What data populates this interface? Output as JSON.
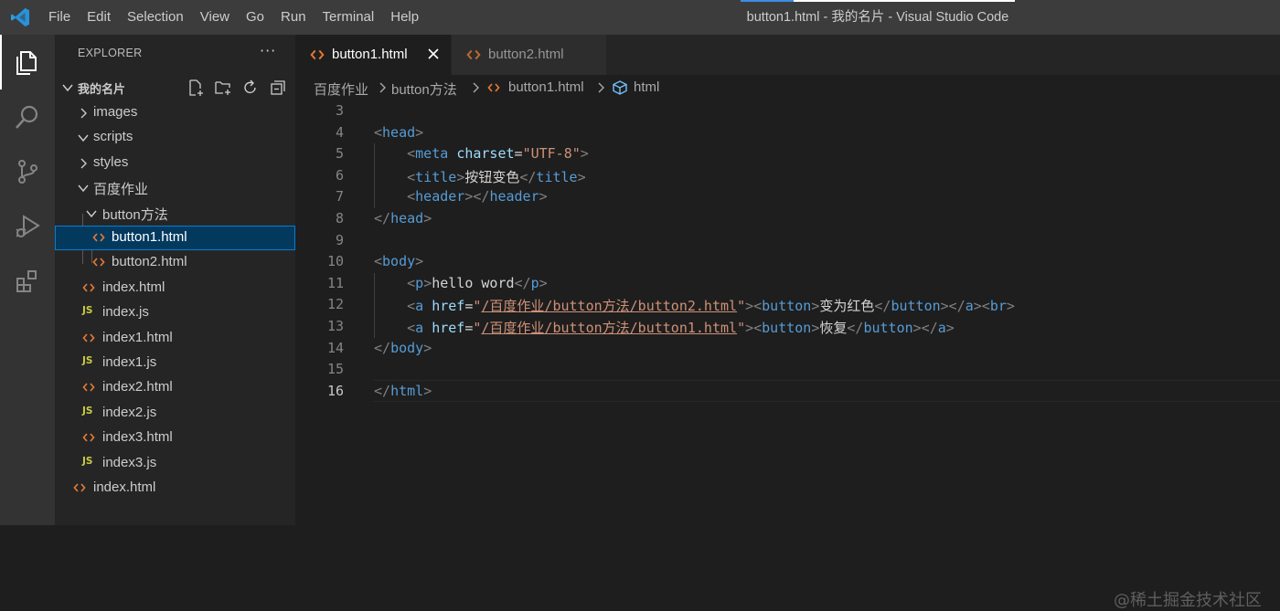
{
  "titlebar": {
    "logo_icon": "vscode-icon",
    "menu": [
      "File",
      "Edit",
      "Selection",
      "View",
      "Go",
      "Run",
      "Terminal",
      "Help"
    ],
    "window_title": "button1.html - 我的名片 - Visual Studio Code"
  },
  "activitybar": {
    "items": [
      "explorer-icon",
      "search-icon",
      "source-control-icon",
      "run-debug-icon",
      "extensions-icon"
    ]
  },
  "sidebar": {
    "title": "EXPLORER",
    "more_label": "···",
    "folder_name": "我的名片",
    "tree": [
      {
        "label": "images",
        "type": "folder",
        "expanded": false
      },
      {
        "label": "scripts",
        "type": "folder",
        "expanded": true
      },
      {
        "label": "styles",
        "type": "folder",
        "expanded": false
      },
      {
        "label": "百度作业",
        "type": "folder",
        "expanded": true
      },
      {
        "label": "button方法",
        "type": "folder",
        "expanded": true
      },
      {
        "label": "button1.html",
        "type": "html",
        "selected": true
      },
      {
        "label": "button2.html",
        "type": "html"
      },
      {
        "label": "index.html",
        "type": "html"
      },
      {
        "label": "index.js",
        "type": "js"
      },
      {
        "label": "index1.html",
        "type": "html"
      },
      {
        "label": "index1.js",
        "type": "js"
      },
      {
        "label": "index2.html",
        "type": "html"
      },
      {
        "label": "index2.js",
        "type": "js"
      },
      {
        "label": "index3.html",
        "type": "html"
      },
      {
        "label": "index3.js",
        "type": "js"
      },
      {
        "label": "index.html",
        "type": "html"
      }
    ],
    "js_badge": "JS"
  },
  "tabs": [
    {
      "label": "button1.html",
      "active": true
    },
    {
      "label": "button2.html",
      "active": false
    }
  ],
  "breadcrumbs": [
    "百度作业",
    "button方法",
    "button1.html",
    "html"
  ],
  "editor": {
    "active_line": "16",
    "lines": [
      {
        "n": "3",
        "text": ""
      },
      {
        "n": "4",
        "text": "<head>"
      },
      {
        "n": "5",
        "text": "    <meta charset=\"UTF-8\">"
      },
      {
        "n": "6",
        "text": "    <title>按钮变色</title>"
      },
      {
        "n": "7",
        "text": "    <header></header>"
      },
      {
        "n": "8",
        "text": "</head>"
      },
      {
        "n": "9",
        "text": ""
      },
      {
        "n": "10",
        "text": "<body>"
      },
      {
        "n": "11",
        "text": "    <p>hello word</p>"
      },
      {
        "n": "12",
        "text": "    <a href=\"/百度作业/button方法/button2.html\"><button>变为红色</button></a><br>"
      },
      {
        "n": "13",
        "text": "    <a href=\"/百度作业/button方法/button1.html\"><button>恢复</button></a>"
      },
      {
        "n": "14",
        "text": "</body>"
      },
      {
        "n": "15",
        "text": ""
      },
      {
        "n": "16",
        "text": "</html>"
      }
    ]
  },
  "watermark": "@稀土掘金技术社区",
  "colors": {
    "html_icon": "#e37933",
    "js_icon": "#cbcb41",
    "accent": "#007fd4",
    "tag": "#569cd6",
    "attr": "#9cdcfe",
    "string": "#ce9178"
  }
}
